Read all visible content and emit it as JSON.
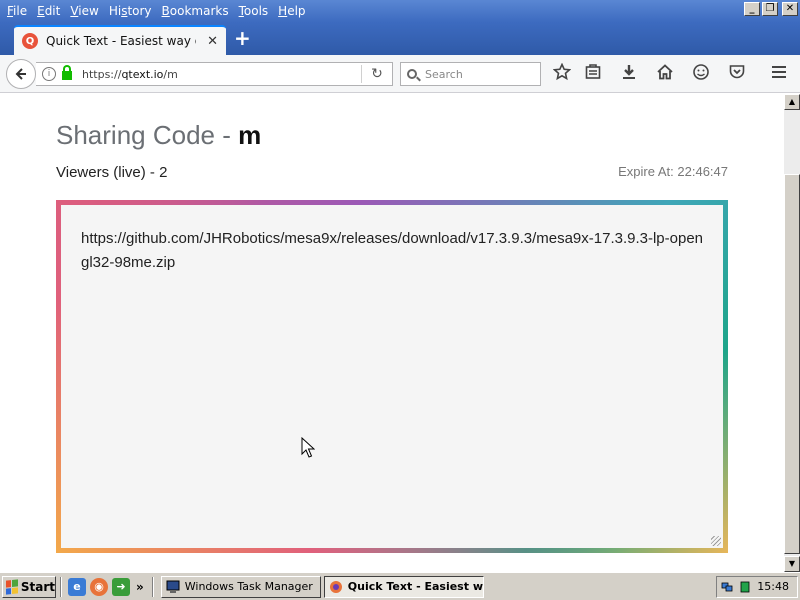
{
  "menubar": {
    "items": [
      "File",
      "Edit",
      "View",
      "History",
      "Bookmarks",
      "Tools",
      "Help"
    ],
    "underline": [
      "F",
      "E",
      "V",
      "s",
      "B",
      "T",
      "H"
    ]
  },
  "window_controls": {
    "minimize": "_",
    "restore": "❐",
    "close": "✕"
  },
  "tab": {
    "title": "Quick Text - Easiest way of o...",
    "favicon": "Q",
    "close": "✕"
  },
  "newtab": "+",
  "urlbar": {
    "scheme": "https://",
    "host": "qtext.io",
    "path": "/m"
  },
  "search": {
    "placeholder": "Search"
  },
  "page": {
    "title_prefix": "Sharing Code - ",
    "code": "m",
    "viewers": "Viewers (live) - 2",
    "expire": "Expire At: 22:46:47",
    "shared_text": "https://github.com/JHRobotics/mesa9x/releases/download/v17.3.9.3/mesa9x-17.3.9.3-lp-opengl32-98me.zip"
  },
  "taskbar": {
    "start": "Start",
    "quicklaunch_more": "»",
    "tasks": [
      {
        "label": "Windows Task Manager",
        "active": false
      },
      {
        "label": "Quick Text - Easiest w...",
        "active": true
      }
    ],
    "clock": "15:48"
  },
  "colors": {
    "accent": "#0a84ff",
    "titlebar": "#3d6bc0",
    "favicon": "#e8533b"
  }
}
